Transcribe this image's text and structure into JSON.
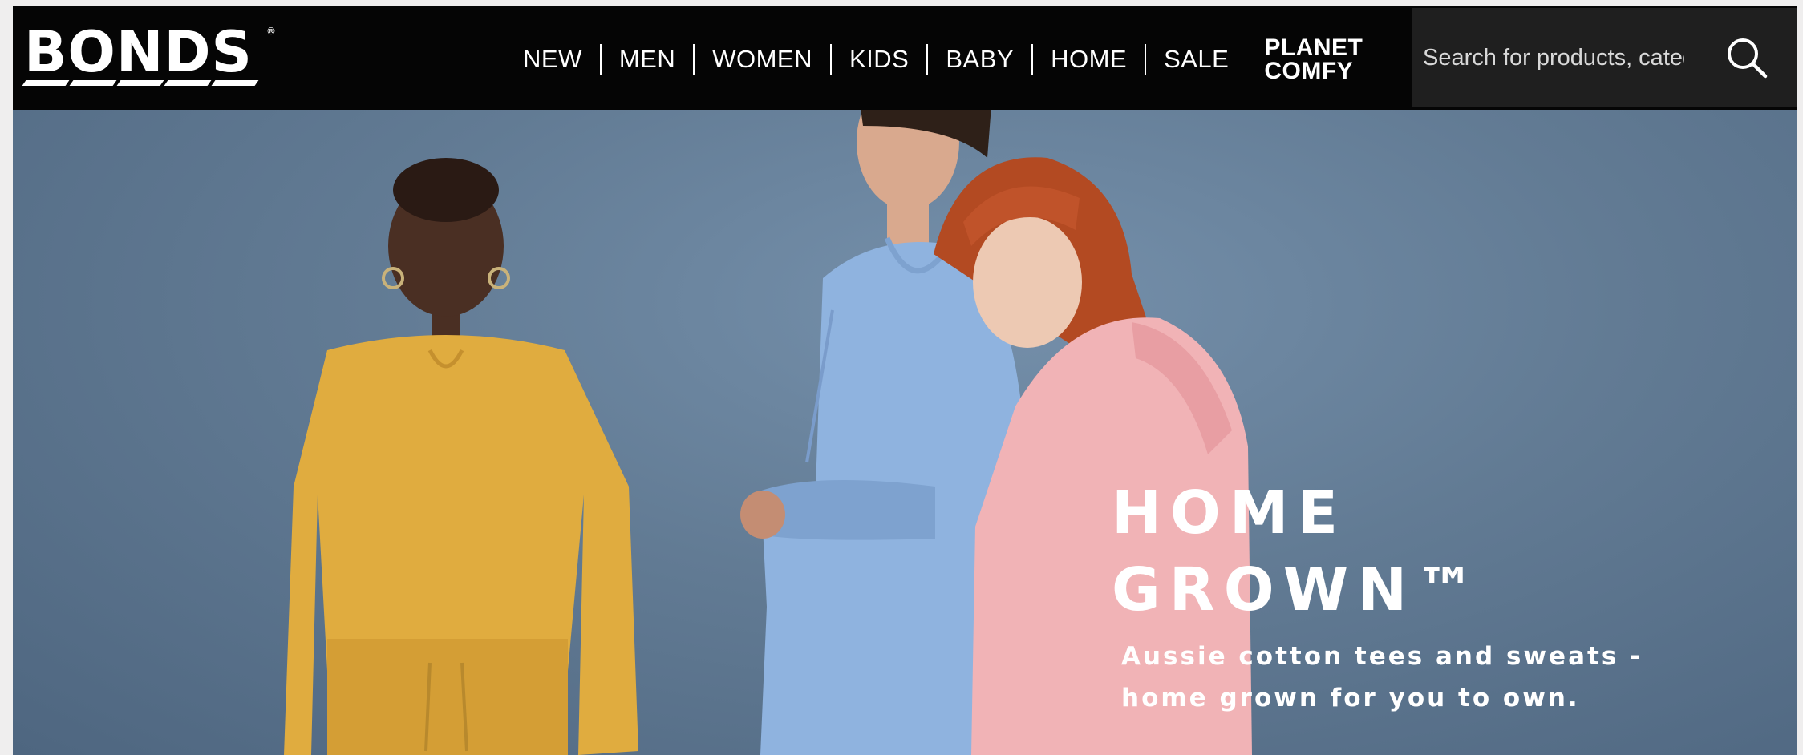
{
  "brand": {
    "name": "BONDS",
    "trademark": "®"
  },
  "nav": {
    "items": [
      "NEW",
      "MEN",
      "WOMEN",
      "KIDS",
      "BABY",
      "HOME",
      "SALE"
    ],
    "planet_comfy": {
      "line1": "PLANET",
      "line2": "COMFY"
    }
  },
  "search": {
    "placeholder": "Search for products, categories",
    "icon": "search-icon"
  },
  "hero": {
    "headline_line1": "HOME",
    "headline_line2": "GROWN™",
    "subtext_line1": "Aussie cotton tees and sweats -",
    "subtext_line2": "home grown for you to own."
  },
  "colors": {
    "header_bg": "#050505",
    "search_bg": "#1f1f1f",
    "hero_bg": "#627b94",
    "yellow_sweat": "#e0ac3f",
    "blue_hoodie": "#8fb3df",
    "pink_hoodie": "#f1b3b6"
  }
}
